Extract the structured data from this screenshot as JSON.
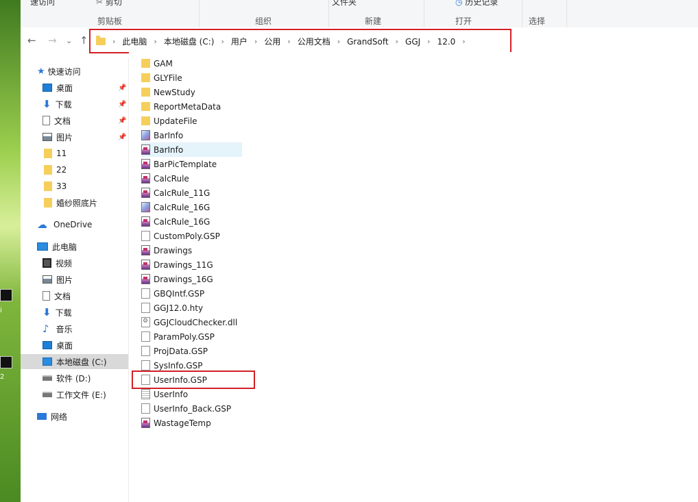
{
  "ribbon": {
    "top_labels": [
      "速访问",
      "剪切",
      "文件夹",
      "历史记录"
    ],
    "groups": [
      "剪贴板",
      "组织",
      "新建",
      "打开",
      "选择"
    ]
  },
  "nav": {
    "back": "←",
    "forward": "→",
    "recent": "⌄",
    "up": "↑"
  },
  "breadcrumb": [
    "此电脑",
    "本地磁盘 (C:)",
    "用户",
    "公用",
    "公用文档",
    "GrandSoft",
    "GGJ",
    "12.0"
  ],
  "sidebar": {
    "quick_access": "快速访问",
    "quick_items": [
      "桌面",
      "下载",
      "文档",
      "图片",
      "11",
      "22",
      "33",
      "婚纱照底片"
    ],
    "onedrive": "OneDrive",
    "this_pc": "此电脑",
    "pc_items": [
      "视频",
      "图片",
      "文档",
      "下载",
      "音乐",
      "桌面",
      "本地磁盘 (C:)",
      "软件 (D:)",
      "工作文件 (E:)"
    ],
    "network": "网络"
  },
  "files": [
    {
      "name": "GAM",
      "icon": "folder-icon"
    },
    {
      "name": "GLYFile",
      "icon": "folder-icon"
    },
    {
      "name": "NewStudy",
      "icon": "folder-icon"
    },
    {
      "name": "ReportMetaData",
      "icon": "folder-icon"
    },
    {
      "name": "UpdateFile",
      "icon": "folder-icon"
    },
    {
      "name": "BarInfo",
      "icon": "settings-file-icon"
    },
    {
      "name": "BarInfo",
      "icon": "app-file-icon"
    },
    {
      "name": "BarPicTemplate",
      "icon": "app-file-icon"
    },
    {
      "name": "CalcRule",
      "icon": "app-file-icon"
    },
    {
      "name": "CalcRule_11G",
      "icon": "app-file-icon"
    },
    {
      "name": "CalcRule_16G",
      "icon": "settings-file-icon"
    },
    {
      "name": "CalcRule_16G",
      "icon": "app-file-icon"
    },
    {
      "name": "CustomPoly.GSP",
      "icon": "file-icon"
    },
    {
      "name": "Drawings",
      "icon": "app-file-icon"
    },
    {
      "name": "Drawings_11G",
      "icon": "app-file-icon"
    },
    {
      "name": "Drawings_16G",
      "icon": "app-file-icon"
    },
    {
      "name": "GBQIntf.GSP",
      "icon": "file-icon"
    },
    {
      "name": "GGJ12.0.hty",
      "icon": "file-icon"
    },
    {
      "name": "GGJCloudChecker.dll",
      "icon": "dll-file-icon"
    },
    {
      "name": "ParamPoly.GSP",
      "icon": "file-icon"
    },
    {
      "name": "ProjData.GSP",
      "icon": "file-icon"
    },
    {
      "name": "SysInfo.GSP",
      "icon": "file-icon"
    },
    {
      "name": "UserInfo.GSP",
      "icon": "file-icon"
    },
    {
      "name": "UserInfo",
      "icon": "ini-file-icon"
    },
    {
      "name": "UserInfo_Back.GSP",
      "icon": "file-icon"
    },
    {
      "name": "WastageTemp",
      "icon": "app-file-icon"
    }
  ],
  "desktop_text": [
    "i",
    "2"
  ],
  "colors": {
    "highlight": "#d21f26",
    "selected_row": "#e5f3fb",
    "selected_nav": "#d9d9d9"
  }
}
